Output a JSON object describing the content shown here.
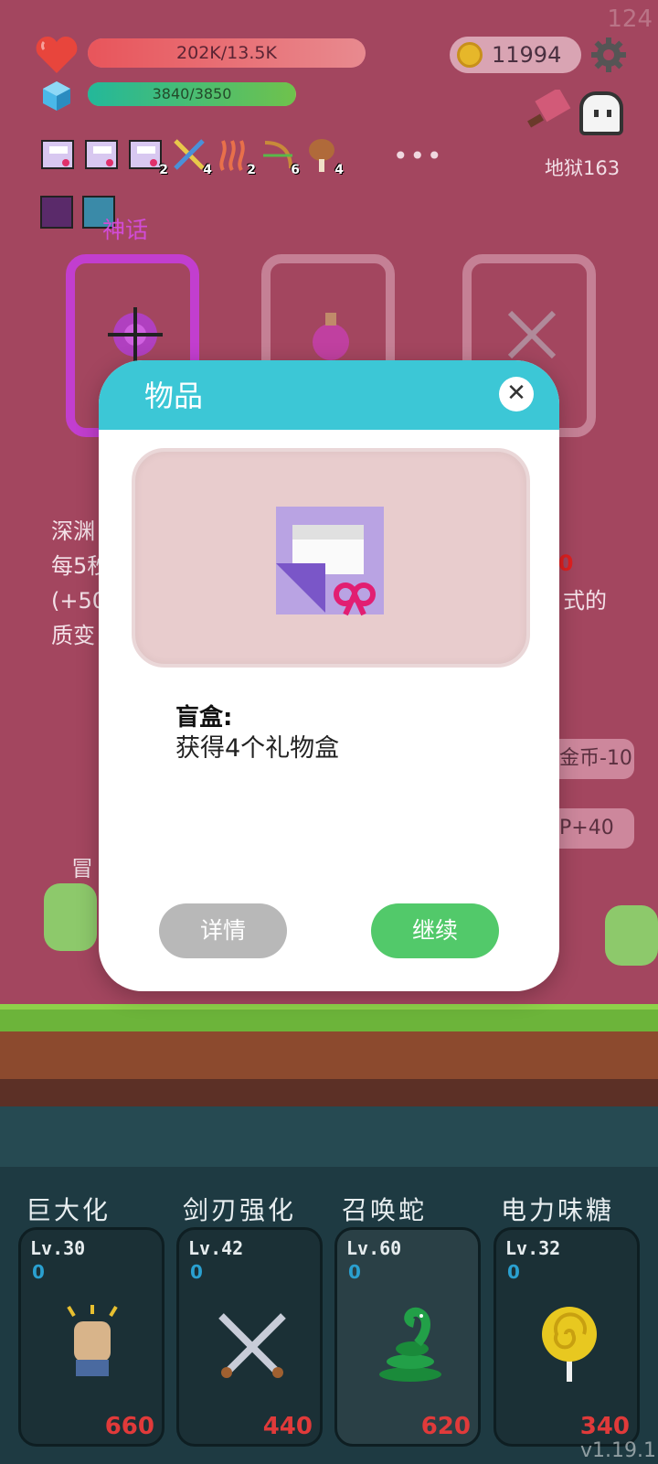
{
  "hud": {
    "fps": "124",
    "hp_text": "202K/13.5K",
    "hp_fraction": 1.0,
    "xp_text": "3840/3850",
    "xp_fraction": 0.997,
    "coins": "11994",
    "stage": "地狱163",
    "more": "•••"
  },
  "items": [
    {
      "icon": "gift-box-icon",
      "count": ""
    },
    {
      "icon": "gift-box-icon",
      "count": ""
    },
    {
      "icon": "gift-box-icon",
      "count": "2"
    },
    {
      "icon": "crossed-tools-icon",
      "count": "4"
    },
    {
      "icon": "heat-waves-icon",
      "count": "2"
    },
    {
      "icon": "bow-arrow-icon",
      "count": "6"
    },
    {
      "icon": "meat-icon",
      "count": "4"
    }
  ],
  "cards": {
    "rarity_label": "神话"
  },
  "bg_panel": {
    "line1": "深渊",
    "line2": "每5秒",
    "line3": "(+50",
    "line4": "质变",
    "red_value": "00",
    "right_text": "式的",
    "btn1": "金币-10",
    "btn2": "P+40",
    "adventure": "冒"
  },
  "skills": [
    {
      "name": "巨大化",
      "level": "Lv.30",
      "points": "0",
      "cost": "660"
    },
    {
      "name": "剑刃强化",
      "level": "Lv.42",
      "points": "0",
      "cost": "440"
    },
    {
      "name": "召唤蛇",
      "level": "Lv.60",
      "points": "0",
      "cost": "620"
    },
    {
      "name": "电力味糖",
      "level": "Lv.32",
      "points": "0",
      "cost": "340"
    }
  ],
  "version": "v1.19.1",
  "modal": {
    "title": "物品",
    "close": "✕",
    "item_name": "盲盒:",
    "item_desc": "获得4个礼物盒",
    "detail_button": "详情",
    "continue_button": "继续"
  },
  "colors": {
    "background": "#a3465f",
    "modal_header": "#3cc7d6",
    "continue_button": "#52c96a",
    "detail_button": "#b8b8b8",
    "cost_red": "#e03a3a"
  }
}
